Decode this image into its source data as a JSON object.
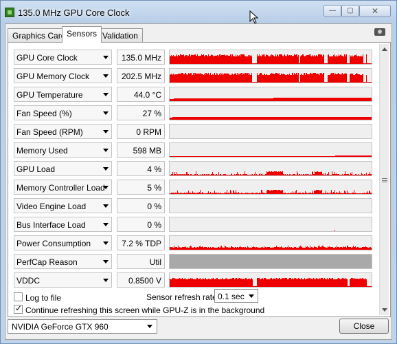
{
  "window": {
    "title": "135.0 MHz GPU Core Clock",
    "min_glyph": "—",
    "max_glyph": "▢",
    "close_glyph": "✕",
    "icon": "gpu-z-icon"
  },
  "tabs": [
    {
      "label": "Graphics Card",
      "active": false
    },
    {
      "label": "Sensors",
      "active": true
    },
    {
      "label": "Validation",
      "active": false
    }
  ],
  "sensors": [
    {
      "name": "GPU Core Clock",
      "value": "135.0 MHz",
      "graph": "clock"
    },
    {
      "name": "GPU Memory Clock",
      "value": "202.5 MHz",
      "graph": "clock"
    },
    {
      "name": "GPU Temperature",
      "value": "44.0 °C",
      "graph": "temp"
    },
    {
      "name": "Fan Speed (%)",
      "value": "27 %",
      "graph": "fan"
    },
    {
      "name": "Fan Speed (RPM)",
      "value": "0 RPM",
      "graph": "empty"
    },
    {
      "name": "Memory Used",
      "value": "598 MB",
      "graph": "memused"
    },
    {
      "name": "GPU Load",
      "value": "4 %",
      "graph": "load"
    },
    {
      "name": "Memory Controller Load",
      "value": "5 %",
      "graph": "mcload"
    },
    {
      "name": "Video Engine Load",
      "value": "0 %",
      "graph": "empty"
    },
    {
      "name": "Bus Interface Load",
      "value": "0 %",
      "graph": "businterface"
    },
    {
      "name": "Power Consumption",
      "value": "7.2 % TDP",
      "graph": "power"
    },
    {
      "name": "PerfCap Reason",
      "value": "Util",
      "graph": "gray"
    },
    {
      "name": "VDDC",
      "value": "0.8500 V",
      "graph": "vddc"
    }
  ],
  "options": {
    "log_to_file": {
      "label": "Log to file",
      "checked": false
    },
    "refresh_rate_label": "Sensor refresh rate:",
    "refresh_rate_value": "0.1 sec",
    "continue_refreshing": {
      "label": "Continue refreshing this screen while GPU-Z is in the background",
      "checked": true
    }
  },
  "footer": {
    "gpu_selected": "NVIDIA GeForce GTX 960",
    "close_label": "Close"
  },
  "colors": {
    "graph_fill": "#ee0000",
    "graph_bg": "#efefef",
    "perfcap_fill": "#a9a9a9"
  }
}
